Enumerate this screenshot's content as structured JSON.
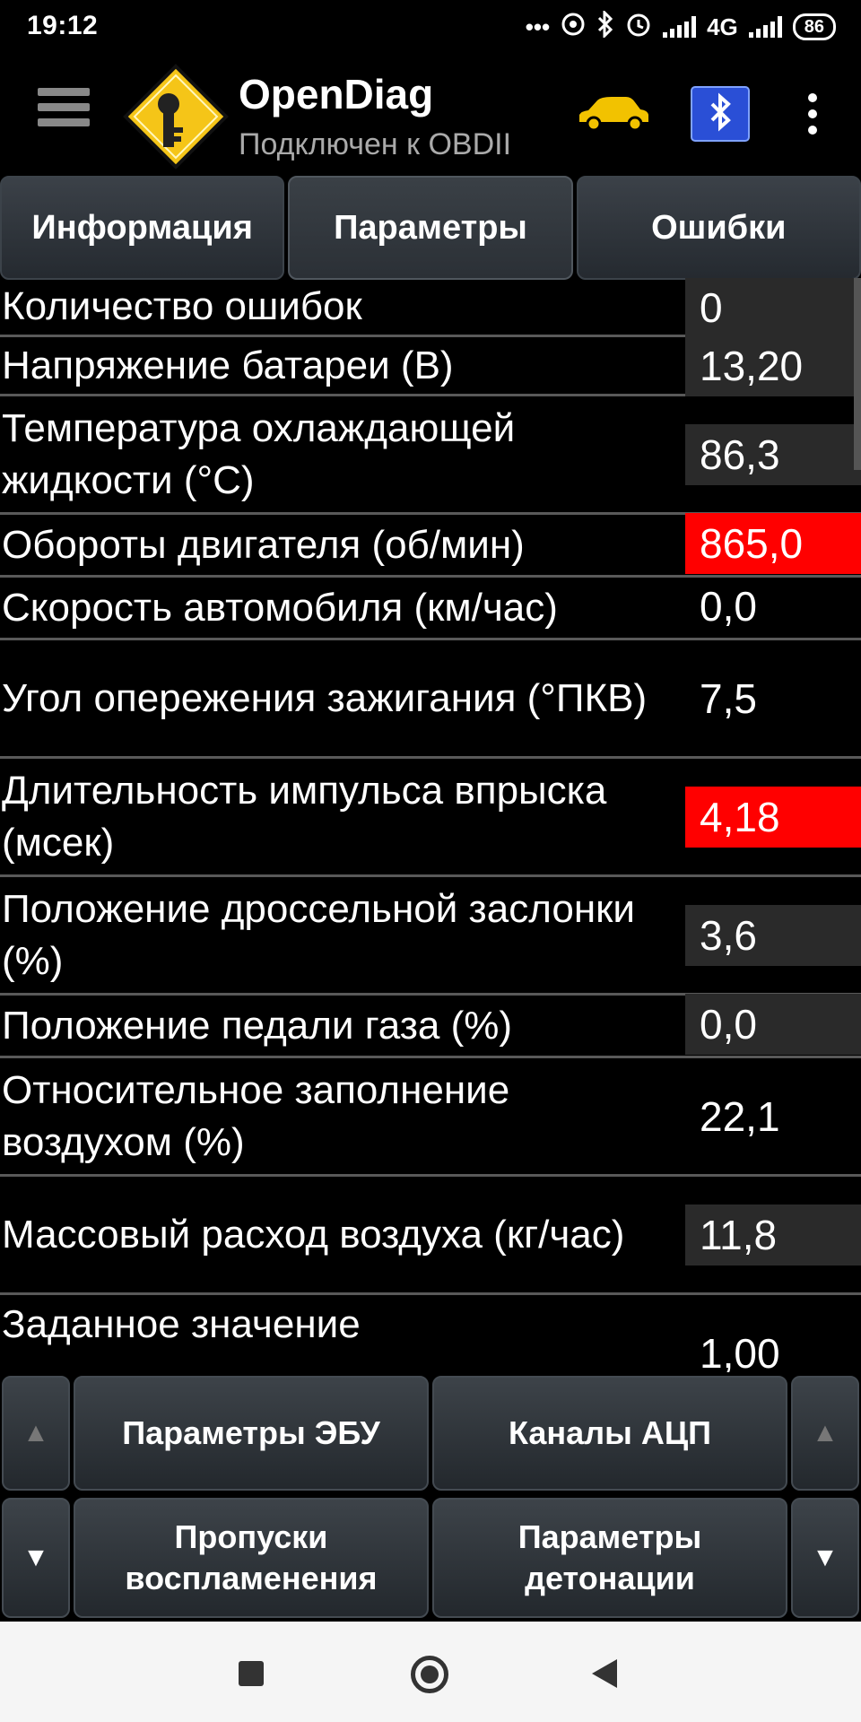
{
  "status_bar": {
    "time": "19:12",
    "dots": "•••",
    "network": "4G",
    "battery": "86",
    "icons": [
      "hotspot-icon",
      "bluetooth-icon",
      "alarm-icon",
      "signal-icon",
      "signal-icon",
      "battery-icon"
    ]
  },
  "header": {
    "title": "OpenDiag",
    "subtitle": "Подключен к OBDII",
    "logo_icon": "key-logo-icon",
    "car_icon": "car-icon",
    "bluetooth_adapter_icon": "bluetooth-adapter-icon",
    "menu_icon": "hamburger-menu-icon",
    "overflow_icon": "more-vert-icon",
    "colors": {
      "logo_yellow": "#f5c518",
      "car_yellow": "#f2c200",
      "bt_blue": "#2a4fd6"
    }
  },
  "tabs": [
    {
      "label": "Информация",
      "active": false
    },
    {
      "label": "Параметры",
      "active": true
    },
    {
      "label": "Ошибки",
      "active": false
    }
  ],
  "parameters": [
    {
      "label": "Количество ошибок",
      "value": "0",
      "highlight": "grey"
    },
    {
      "label": "Напряжение батареи (В)",
      "value": "13,20",
      "highlight": "grey"
    },
    {
      "label": "Температура охлаждающей жидкости (°С)",
      "value": "86,3",
      "highlight": "grey"
    },
    {
      "label": "Обороты двигателя (об/мин)",
      "value": "865,0",
      "highlight": "red"
    },
    {
      "label": "Скорость автомобиля (км/час)",
      "value": "0,0",
      "highlight": "none"
    },
    {
      "label": "Угол опережения зажигания (°ПКВ)",
      "value": "7,5",
      "highlight": "none"
    },
    {
      "label": "Длительность импульса впрыска (мсек)",
      "value": "4,18",
      "highlight": "red"
    },
    {
      "label": "Положение дроссельной заслонки (%)",
      "value": "3,6",
      "highlight": "grey"
    },
    {
      "label": "Положение педали газа (%)",
      "value": "0,0",
      "highlight": "grey"
    },
    {
      "label": "Относительное заполнение воздухом (%)",
      "value": "22,1",
      "highlight": "none"
    },
    {
      "label": "Массовый расход воздуха (кг/час)",
      "value": "11,8",
      "highlight": "grey"
    },
    {
      "label": "Заданное значение",
      "value": "1,00",
      "highlight": "none"
    }
  ],
  "controls": {
    "up_arrow": "▲",
    "down_arrow": "▼",
    "ecu_params": "Параметры ЭБУ",
    "adc_channels": "Каналы АЦП",
    "misfires_line1": "Пропуски",
    "misfires_line2": "воспламенения",
    "knock_line1": "Параметры",
    "knock_line2": "детонации"
  },
  "navbar": {
    "recents_icon": "square-recents-icon",
    "home_icon": "circle-home-icon",
    "back_icon": "triangle-back-icon"
  },
  "colors": {
    "alert_red": "#ff0000",
    "value_grey": "#2a2a2a",
    "background": "#000000"
  }
}
